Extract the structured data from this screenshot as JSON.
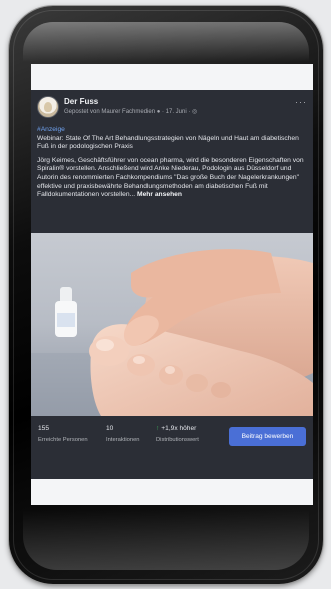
{
  "post": {
    "page_name": "Der Fuss",
    "meta": "Gepostet von Maurer Fachmedien ● · 17. Juni · ◎",
    "more_label": "···",
    "hashtag": "#Anzeige",
    "title": "Webinar: State Of The Art Behandlungsstrategien von Nägeln und Haut am diabetischen Fuß in der podologischen Praxis",
    "body": "Jörg Keimes, Geschäftsführer von ocean pharma, wird die besonderen Eigenschaften von Spiralin® vorstellen. Anschließend wird Anke Niederau, Podologin aus Düsseldorf und Autorin des renommierten Fachkompendiums \"Das große Buch der Nagelerkrankungen\" effektive und praxisbewährte Behandlungsmethoden am diabetischen Fuß mit Falldokumentationen vorstellen...",
    "see_more": "Mehr ansehen"
  },
  "stats": {
    "reach": {
      "value": "155",
      "label": "Erreichte Personen"
    },
    "interactions": {
      "value": "10",
      "label": "Interaktionen"
    },
    "distribution": {
      "arrow": "↑",
      "value": "+1,9x höher",
      "label": "Distributionswert"
    }
  },
  "boost_button": "Beitrag bewerben",
  "colors": {
    "post_background": "#2b2e36",
    "accent_blue": "#4a6fd6",
    "hashtag_blue": "#6fa2f0",
    "positive_green": "#41b35d"
  }
}
